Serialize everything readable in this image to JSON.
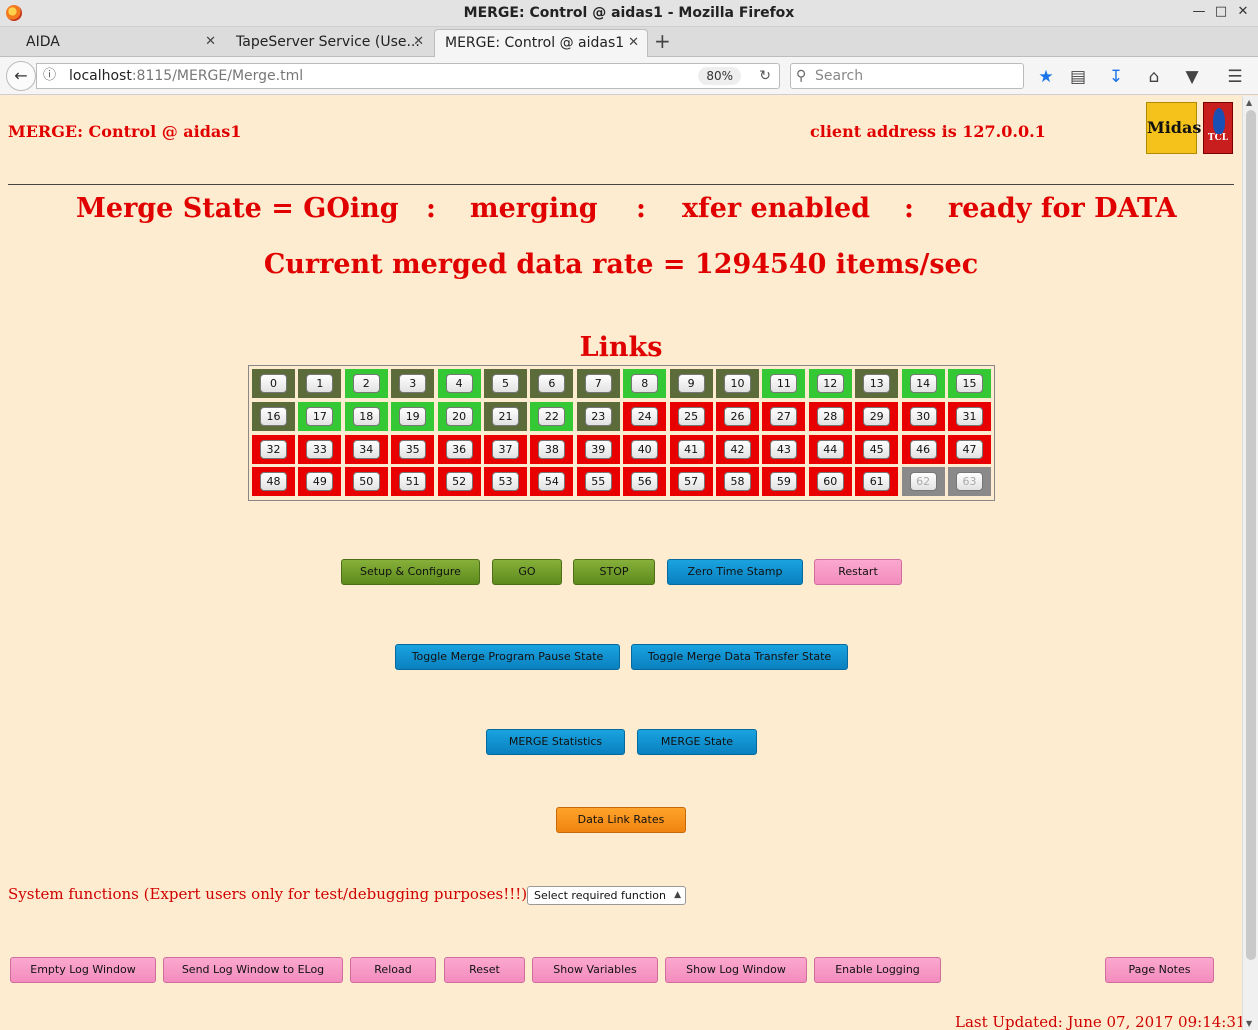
{
  "window": {
    "title": "MERGE: Control @ aidas1 - Mozilla Firefox"
  },
  "tabs": [
    {
      "label": "AIDA"
    },
    {
      "label": "TapeServer Service (Use..."
    },
    {
      "label": "MERGE: Control @ aidas1"
    }
  ],
  "navbar": {
    "url_host": "localhost",
    "url_rest": ":8115/MERGE/Merge.tml",
    "zoom": "80%",
    "search_placeholder": "Search"
  },
  "header": {
    "title": "MERGE: Control @ aidas1",
    "client_address": "client address is 127.0.0.1",
    "logo_midas": "Midas",
    "logo_tcl": "TCL"
  },
  "status": {
    "state": "Merge State = GOing",
    "sep": ":",
    "merging": "merging",
    "xfer": "xfer enabled",
    "ready": "ready for DATA",
    "rate": "Current merged data rate = 1294540 items/sec"
  },
  "links": {
    "title": "Links",
    "colors": {
      "olive": "#5c6b3a",
      "green": "#34c934",
      "red": "#e80000",
      "grey": "#8a8a8a"
    },
    "items": [
      {
        "label": "0",
        "status": "olive"
      },
      {
        "label": "1",
        "status": "olive"
      },
      {
        "label": "2",
        "status": "green"
      },
      {
        "label": "3",
        "status": "olive"
      },
      {
        "label": "4",
        "status": "green"
      },
      {
        "label": "5",
        "status": "olive"
      },
      {
        "label": "6",
        "status": "olive"
      },
      {
        "label": "7",
        "status": "olive"
      },
      {
        "label": "8",
        "status": "green"
      },
      {
        "label": "9",
        "status": "olive"
      },
      {
        "label": "10",
        "status": "olive"
      },
      {
        "label": "11",
        "status": "green"
      },
      {
        "label": "12",
        "status": "green"
      },
      {
        "label": "13",
        "status": "olive"
      },
      {
        "label": "14",
        "status": "green"
      },
      {
        "label": "15",
        "status": "green"
      },
      {
        "label": "16",
        "status": "olive"
      },
      {
        "label": "17",
        "status": "green"
      },
      {
        "label": "18",
        "status": "green"
      },
      {
        "label": "19",
        "status": "green"
      },
      {
        "label": "20",
        "status": "green"
      },
      {
        "label": "21",
        "status": "olive"
      },
      {
        "label": "22",
        "status": "green"
      },
      {
        "label": "23",
        "status": "olive"
      },
      {
        "label": "24",
        "status": "red"
      },
      {
        "label": "25",
        "status": "red"
      },
      {
        "label": "26",
        "status": "red"
      },
      {
        "label": "27",
        "status": "red"
      },
      {
        "label": "28",
        "status": "red"
      },
      {
        "label": "29",
        "status": "red"
      },
      {
        "label": "30",
        "status": "red"
      },
      {
        "label": "31",
        "status": "red"
      },
      {
        "label": "32",
        "status": "red"
      },
      {
        "label": "33",
        "status": "red"
      },
      {
        "label": "34",
        "status": "red"
      },
      {
        "label": "35",
        "status": "red"
      },
      {
        "label": "36",
        "status": "red"
      },
      {
        "label": "37",
        "status": "red"
      },
      {
        "label": "38",
        "status": "red"
      },
      {
        "label": "39",
        "status": "red"
      },
      {
        "label": "40",
        "status": "red"
      },
      {
        "label": "41",
        "status": "red"
      },
      {
        "label": "42",
        "status": "red"
      },
      {
        "label": "43",
        "status": "red"
      },
      {
        "label": "44",
        "status": "red"
      },
      {
        "label": "45",
        "status": "red"
      },
      {
        "label": "46",
        "status": "red"
      },
      {
        "label": "47",
        "status": "red"
      },
      {
        "label": "48",
        "status": "red"
      },
      {
        "label": "49",
        "status": "red"
      },
      {
        "label": "50",
        "status": "red"
      },
      {
        "label": "51",
        "status": "red"
      },
      {
        "label": "52",
        "status": "red"
      },
      {
        "label": "53",
        "status": "red"
      },
      {
        "label": "54",
        "status": "red"
      },
      {
        "label": "55",
        "status": "red"
      },
      {
        "label": "56",
        "status": "red"
      },
      {
        "label": "57",
        "status": "red"
      },
      {
        "label": "58",
        "status": "red"
      },
      {
        "label": "59",
        "status": "red"
      },
      {
        "label": "60",
        "status": "red"
      },
      {
        "label": "61",
        "status": "red"
      },
      {
        "label": "62",
        "status": "grey"
      },
      {
        "label": "63",
        "status": "grey"
      }
    ]
  },
  "controls": {
    "setup": "Setup & Configure",
    "go": "GO",
    "stop": "STOP",
    "zero_ts": "Zero Time Stamp",
    "restart": "Restart",
    "toggle_pause": "Toggle Merge Program Pause State",
    "toggle_xfer": "Toggle Merge Data Transfer State",
    "stats": "MERGE Statistics",
    "state": "MERGE State",
    "rates": "Data Link Rates"
  },
  "system": {
    "label": "System functions (Expert users only for test/debugging purposes!!!)",
    "select_value": "Select required function"
  },
  "footer": {
    "empty_log": "Empty Log Window",
    "send_log": "Send Log Window to ELog",
    "reload": "Reload",
    "reset": "Reset",
    "show_vars": "Show Variables",
    "show_log": "Show Log Window",
    "enable_log": "Enable Logging",
    "page_notes": "Page Notes",
    "updated": "Last Updated: June 07, 2017 09:14:31"
  }
}
